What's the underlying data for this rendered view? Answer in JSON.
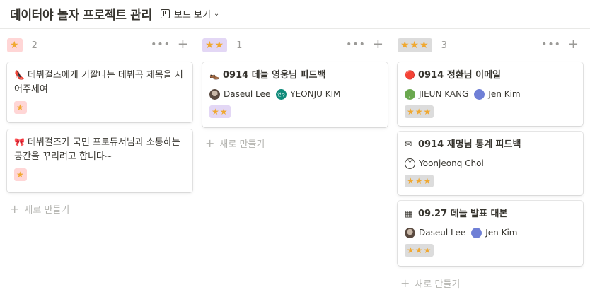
{
  "header": {
    "title": "데이터야 놀자 프로젝트 관리",
    "view_label": "보드 보기",
    "view_icon": "board-icon"
  },
  "colors": {
    "one_star_tag": "#ffd6d6",
    "two_star_tag": "#e3d7f5",
    "three_star_tag": "#dcdcdc",
    "star": "#f0a830"
  },
  "columns": [
    {
      "tag": "★",
      "count": "2",
      "new_label": "새로 만들기",
      "cards": [
        {
          "emoji": "👠",
          "title": "데뷔걸즈에게 기깔나는 데뷔곡 제목을 지어주세여",
          "people": [],
          "tag": "★"
        },
        {
          "emoji": "🎀",
          "title": "데뷔걸즈가 국민 프로듀서님과 소통하는 공간을 꾸리려고 합니다~",
          "people": [],
          "tag": "★"
        }
      ]
    },
    {
      "tag": "★★",
      "count": "1",
      "new_label": "새로 만들기",
      "cards": [
        {
          "emoji": "👞",
          "title": "0914 데늘 영웅님 피드백",
          "people": [
            {
              "name": "Daseul Lee",
              "avatar": ""
            },
            {
              "name": "YEONJU KIM",
              "avatar": "연주"
            }
          ],
          "tag": "★★"
        }
      ]
    },
    {
      "tag": "★★★",
      "count": "3",
      "new_label": "새로 만들기",
      "cards": [
        {
          "emoji": "🔴",
          "title": "0914 정환님 이메일",
          "people": [
            {
              "name": "JIEUN KANG",
              "avatar": "J"
            },
            {
              "name": "Jen Kim",
              "avatar": ""
            }
          ],
          "tag": "★★★"
        },
        {
          "emoji": "✉",
          "title": "0914 재명님 통계 피드백",
          "people": [
            {
              "name": "Yoonjeonq Choi",
              "avatar": "Y"
            }
          ],
          "tag": "★★★"
        },
        {
          "emoji": "▦",
          "title": "09.27 데늘 발표 대본",
          "people": [
            {
              "name": "Daseul Lee",
              "avatar": ""
            },
            {
              "name": "Jen Kim",
              "avatar": ""
            }
          ],
          "tag": "★★★"
        }
      ]
    }
  ]
}
